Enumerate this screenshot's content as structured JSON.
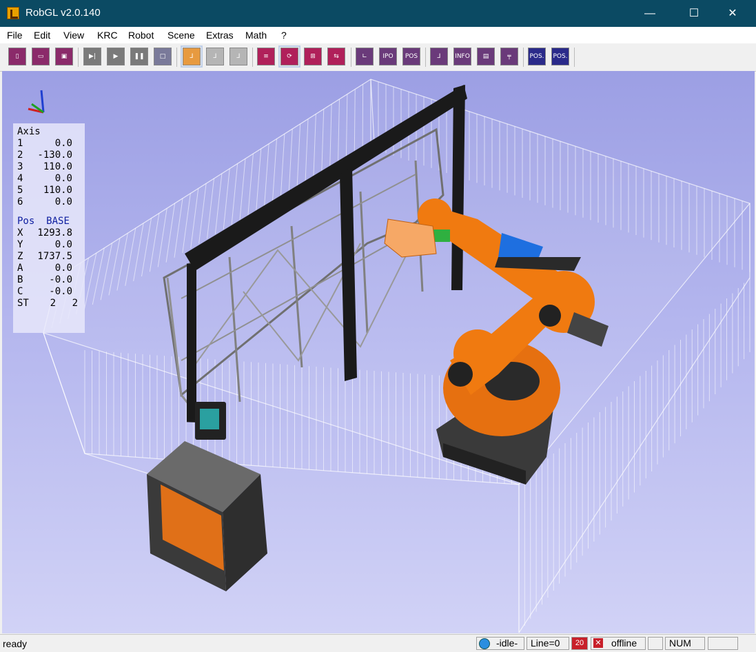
{
  "window": {
    "title": "RobGL v2.0.140",
    "minimize": "—",
    "maximize": "☐",
    "close": "✕"
  },
  "menu": [
    "File",
    "Edit",
    "View",
    "KRC",
    "Robot",
    "Scene",
    "Extras",
    "Math",
    "?"
  ],
  "toolbar": {
    "new": "new-file",
    "open": "open-file",
    "save": "save-file",
    "step": "step",
    "play": "play",
    "pause": "pause",
    "stop": "stop",
    "robot1": "robot-view",
    "robot2": "robot-axis",
    "robot3": "robot-ext",
    "ipo": "IPO",
    "pos": "POS",
    "info": "INFO",
    "pos2": "POS.",
    "pos3": "POS."
  },
  "overlay": {
    "axis_title": "Axis",
    "axes": [
      {
        "n": "1",
        "v": "0.0"
      },
      {
        "n": "2",
        "v": "-130.0"
      },
      {
        "n": "3",
        "v": "110.0"
      },
      {
        "n": "4",
        "v": "0.0"
      },
      {
        "n": "5",
        "v": "110.0"
      },
      {
        "n": "6",
        "v": "0.0"
      }
    ],
    "pos_title": "Pos",
    "pos_base": "BASE",
    "pos": [
      {
        "n": "X",
        "v": "1293.8"
      },
      {
        "n": "Y",
        "v": "0.0"
      },
      {
        "n": "Z",
        "v": "1737.5"
      },
      {
        "n": "A",
        "v": "0.0"
      },
      {
        "n": "B",
        "v": "-0.0"
      },
      {
        "n": "C",
        "v": "-0.0"
      }
    ],
    "st_label": "ST",
    "st_a": "2",
    "st_b": "2"
  },
  "status": {
    "left": "ready",
    "state": "-idle-",
    "line": "Line=0",
    "counter": "20",
    "online": "offline",
    "num": "NUM"
  },
  "colors": {
    "titlebar": "#0b4a63",
    "robot": "#f07a10",
    "sky_top": "#9c9fe4",
    "sky_bottom": "#d1d2f6"
  }
}
